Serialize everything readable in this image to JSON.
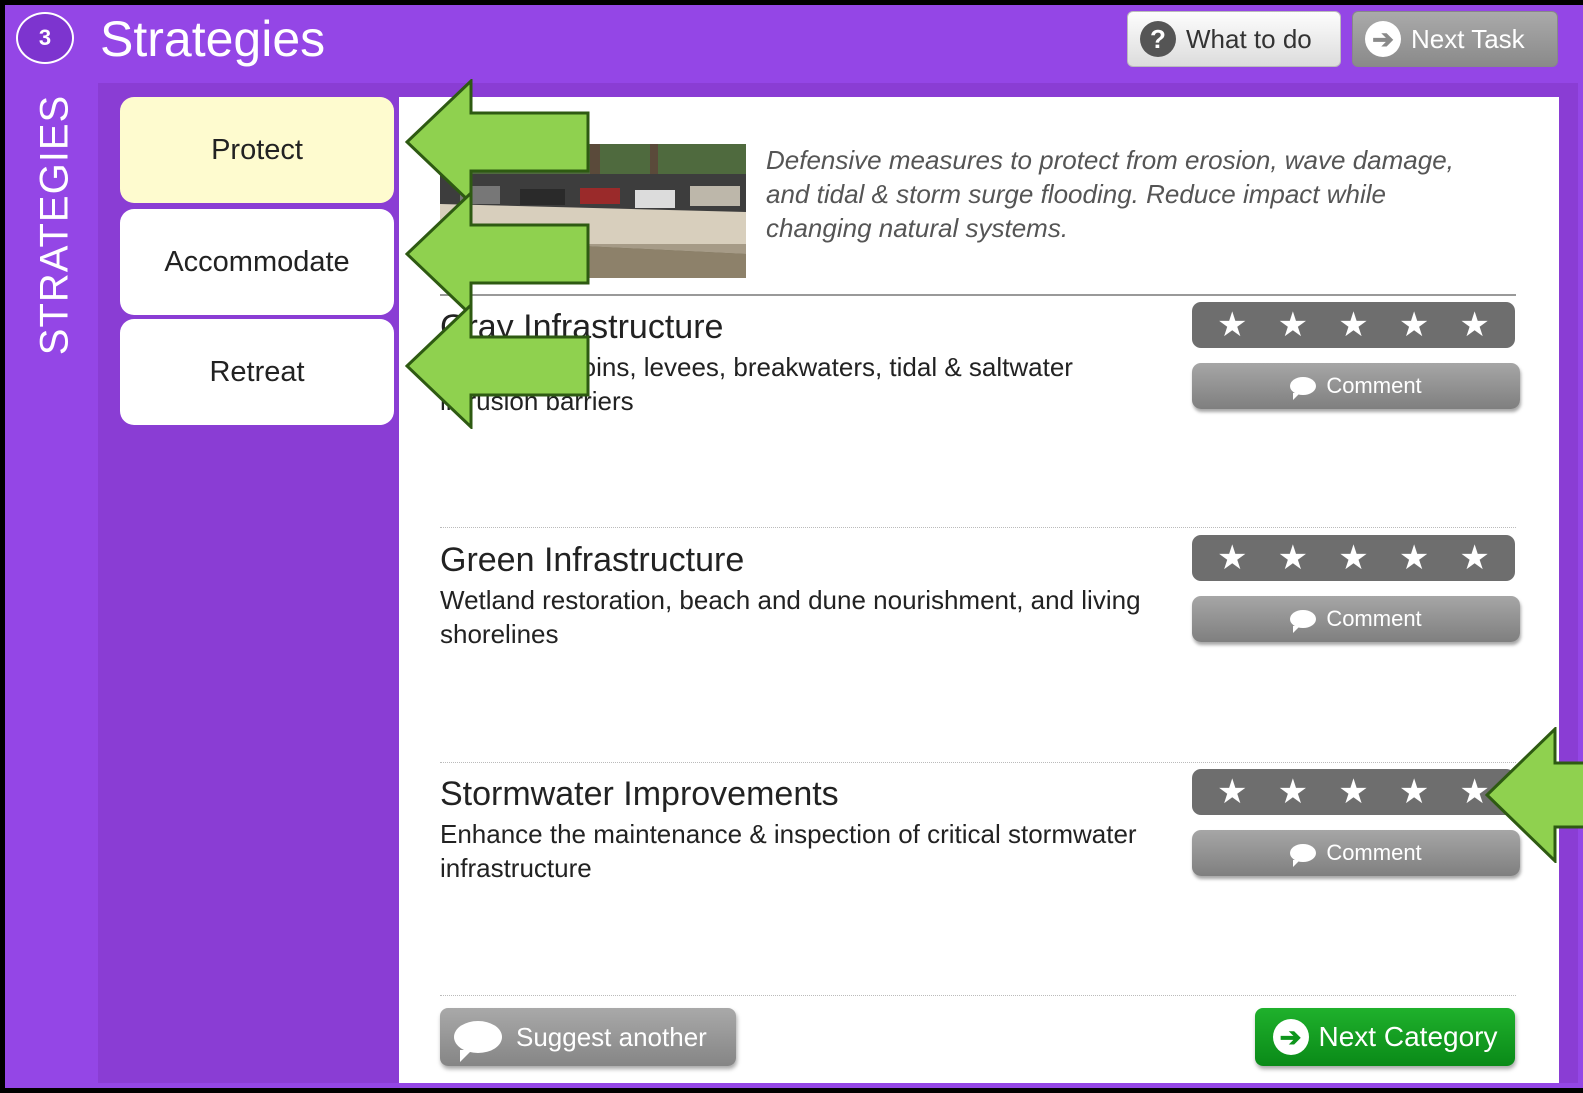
{
  "header": {
    "step_number": "3",
    "title": "Strategies",
    "what_to_do_label": "What to do",
    "next_task_label": "Next Task"
  },
  "sidebar": {
    "vertical_label": "STRATEGIES"
  },
  "categories": [
    {
      "label": "Protect",
      "active": true
    },
    {
      "label": "Accommodate",
      "active": false
    },
    {
      "label": "Retreat",
      "active": false
    }
  ],
  "intro_text": "Defensive measures to protect from erosion, wave damage, and tidal & storm surge flooding. Reduce impact while changing natural systems.",
  "strategies": [
    {
      "title": "Gray Infrastructure",
      "description": "Seawalls, groins, levees, breakwaters, tidal & saltwater intrusion barriers",
      "rating": 0,
      "max_rating": 5,
      "comment_label": "Comment"
    },
    {
      "title": "Green Infrastructure",
      "description": "Wetland restoration, beach and dune nourishment, and living shorelines",
      "rating": 0,
      "max_rating": 5,
      "comment_label": "Comment"
    },
    {
      "title": "Stormwater Improvements",
      "description": "Enhance the maintenance & inspection of critical stormwater infrastructure",
      "rating": 0,
      "max_rating": 5,
      "comment_label": "Comment"
    }
  ],
  "footer": {
    "suggest_label": "Suggest another",
    "next_category_label": "Next Category"
  },
  "colors": {
    "frame": "#9446e6",
    "panel": "#8a3dd4",
    "active_category": "#fefbcf",
    "annotation_arrow": "#8fd14f",
    "next_category": "#0e951c"
  }
}
